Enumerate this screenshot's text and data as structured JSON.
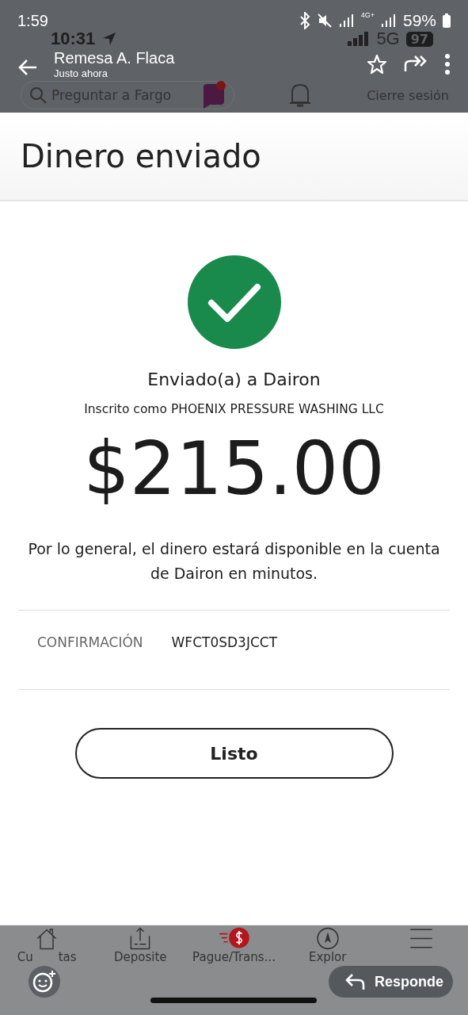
{
  "outer_status": {
    "time": "1:59",
    "network": "4G+",
    "battery": "59%"
  },
  "chat_header": {
    "title": "Remesa A. Flaca",
    "subtitle": "Justo ahora"
  },
  "app": {
    "status": {
      "time": "10:31",
      "network": "5G",
      "battery": "97"
    },
    "search": {
      "placeholder": "Preguntar a Fargo"
    },
    "logout": "Cierre sesión",
    "page_title": "Dinero enviado",
    "recipient": "Enviado(a) a Dairon",
    "enrolled": "Inscrito como PHOENIX PRESSURE WASHING LLC",
    "amount": "$215.00",
    "note": "Por lo general, el dinero estará disponible en la cuenta de Dairon en minutos.",
    "confirmation": {
      "label": "CONFIRMACIÓN",
      "value": "WFCT0SD3JCCT"
    },
    "done_button": "Listo",
    "nav": [
      {
        "kind": "home",
        "label_parts": [
          "Cu",
          "tas"
        ],
        "selected": false
      },
      {
        "kind": "deposit",
        "label_parts": [
          "Deposite"
        ],
        "selected": false
      },
      {
        "kind": "pay",
        "label_parts": [
          "Pague/Trans..."
        ],
        "selected": true
      },
      {
        "kind": "explore",
        "label_parts": [
          "Explor"
        ],
        "selected": false
      },
      {
        "kind": "menu",
        "selected": false
      }
    ]
  },
  "reply_button": {
    "label": "Responde"
  }
}
